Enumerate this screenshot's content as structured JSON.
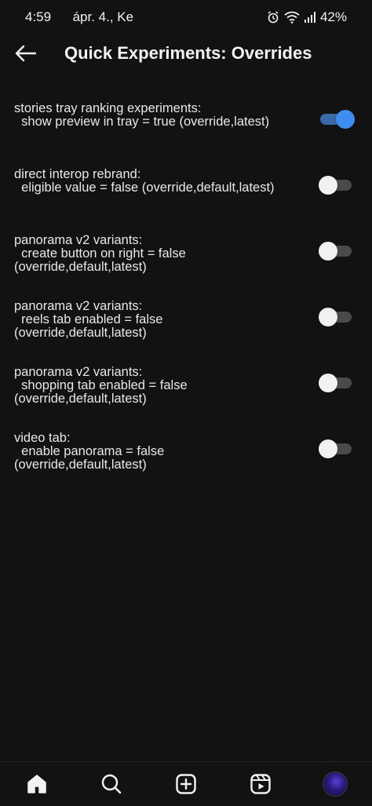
{
  "status": {
    "time": "4:59",
    "date": "ápr. 4., Ke",
    "battery": "42%",
    "icons": [
      "alarm-icon",
      "wifi-icon",
      "signal-icon"
    ]
  },
  "header": {
    "title": "Quick Experiments: Overrides",
    "back_icon": "arrow-left-icon"
  },
  "items": [
    {
      "label": "stories tray ranking experiments:\n  show preview in tray = true (override,latest)",
      "enabled": true
    },
    {
      "label": "direct interop rebrand:\n  eligible value = false (override,default,latest)",
      "enabled": false
    },
    {
      "label": "panorama v2 variants:\n  create button on right = false\n(override,default,latest)",
      "enabled": false
    },
    {
      "label": "panorama v2 variants:\n  reels tab enabled = false\n(override,default,latest)",
      "enabled": false
    },
    {
      "label": "panorama v2 variants:\n  shopping tab enabled = false\n(override,default,latest)",
      "enabled": false
    },
    {
      "label": "video tab:\n  enable panorama = false\n(override,default,latest)",
      "enabled": false
    }
  ],
  "bottom_nav": [
    "home-icon",
    "search-icon",
    "create-icon",
    "reels-icon",
    "profile-avatar"
  ],
  "colors": {
    "accent": "#3d8ef0",
    "background": "#121212"
  }
}
